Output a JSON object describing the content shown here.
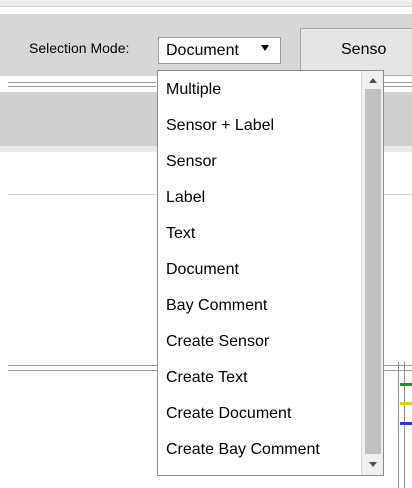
{
  "toolbar": {
    "selection_mode_label": "Selection Mode:",
    "selected_value": "Document",
    "sensor_button_label": "Senso"
  },
  "dropdown": {
    "options": [
      "Multiple",
      "Sensor + Label",
      "Sensor",
      "Label",
      "Text",
      "Document",
      "Bay Comment",
      "Create Sensor",
      "Create Text",
      "Create Document",
      "Create Bay Comment"
    ]
  },
  "colors": {
    "toolbar_bg": "#d7d7d7",
    "wire_green": "#2e8b2e",
    "wire_yellow": "#e0d000",
    "wire_blue": "#2040c0"
  },
  "icons": [
    "dropdown-arrow-icon",
    "scroll-up-icon",
    "scroll-down-icon"
  ]
}
